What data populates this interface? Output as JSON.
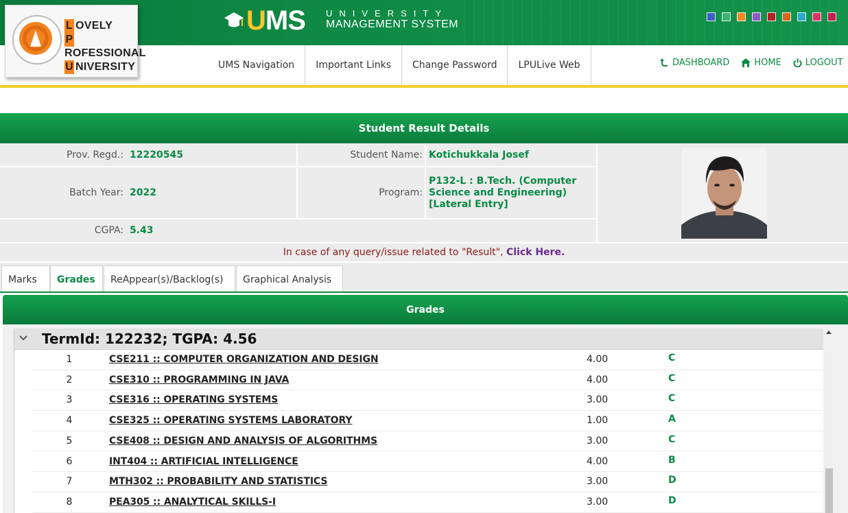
{
  "header": {
    "logo": {
      "line1_initial": "L",
      "line1_rest": "OVELY",
      "line2_initial": "P",
      "line2_rest": "ROFESSIONAL",
      "line3_initial": "U",
      "line3_rest": "NIVERSITY"
    },
    "brand": {
      "ums_u": "U",
      "ums_ms": "MS",
      "sub_line1": "UNIVERSITY",
      "sub_line2": "MANAGEMENT SYSTEM"
    },
    "theme_colors": [
      "#3a5fc8",
      "#3cb371",
      "#f08a24",
      "#8e5cc0",
      "#b22222",
      "#d2691e",
      "#2fa8c8",
      "#e0306a",
      "#c02050"
    ],
    "nav": [
      "UMS Navigation",
      "Important Links",
      "Change Password",
      "LPULive Web"
    ],
    "quick_links": {
      "dashboard": "DASHBOARD",
      "home": "HOME",
      "logout": "LOGOUT"
    }
  },
  "result": {
    "title": "Student Result Details",
    "prov_regd_label": "Prov. Regd.:",
    "prov_regd": "12220545",
    "student_name_label": "Student Name:",
    "student_name": "Kotichukkala Josef",
    "batch_year_label": "Batch Year:",
    "batch_year": "2022",
    "program_label": "Program:",
    "program": "P132-L : B.Tech. (Computer Science and Engineering) [Lateral Entry]",
    "cgpa_label": "CGPA:",
    "cgpa": "5.43",
    "notice_text": "In case of any query/issue related to \"Result\", ",
    "notice_link": "Click Here."
  },
  "tabs": [
    "Marks",
    "Grades",
    "ReAppear(s)/Backlog(s)",
    "Graphical Analysis"
  ],
  "grades": {
    "title": "Grades",
    "term_title": "TermId: 122232; TGPA: 4.56",
    "rows": [
      {
        "sno": "1",
        "course": "CSE211 :: COMPUTER ORGANIZATION AND DESIGN",
        "credits": "4.00",
        "grade": "C"
      },
      {
        "sno": "2",
        "course": "CSE310 :: PROGRAMMING IN JAVA",
        "credits": "4.00",
        "grade": "C"
      },
      {
        "sno": "3",
        "course": "CSE316 :: OPERATING SYSTEMS",
        "credits": "3.00",
        "grade": "C"
      },
      {
        "sno": "4",
        "course": "CSE325 :: OPERATING SYSTEMS LABORATORY",
        "credits": "1.00",
        "grade": "A"
      },
      {
        "sno": "5",
        "course": "CSE408 :: DESIGN AND ANALYSIS OF ALGORITHMS",
        "credits": "3.00",
        "grade": "C"
      },
      {
        "sno": "6",
        "course": "INT404 :: ARTIFICIAL INTELLIGENCE",
        "credits": "4.00",
        "grade": "B"
      },
      {
        "sno": "7",
        "course": "MTH302 :: PROBABILITY AND STATISTICS",
        "credits": "3.00",
        "grade": "D"
      },
      {
        "sno": "8",
        "course": "PEA305 :: ANALYTICAL SKILLS-I",
        "credits": "3.00",
        "grade": "D"
      }
    ]
  }
}
